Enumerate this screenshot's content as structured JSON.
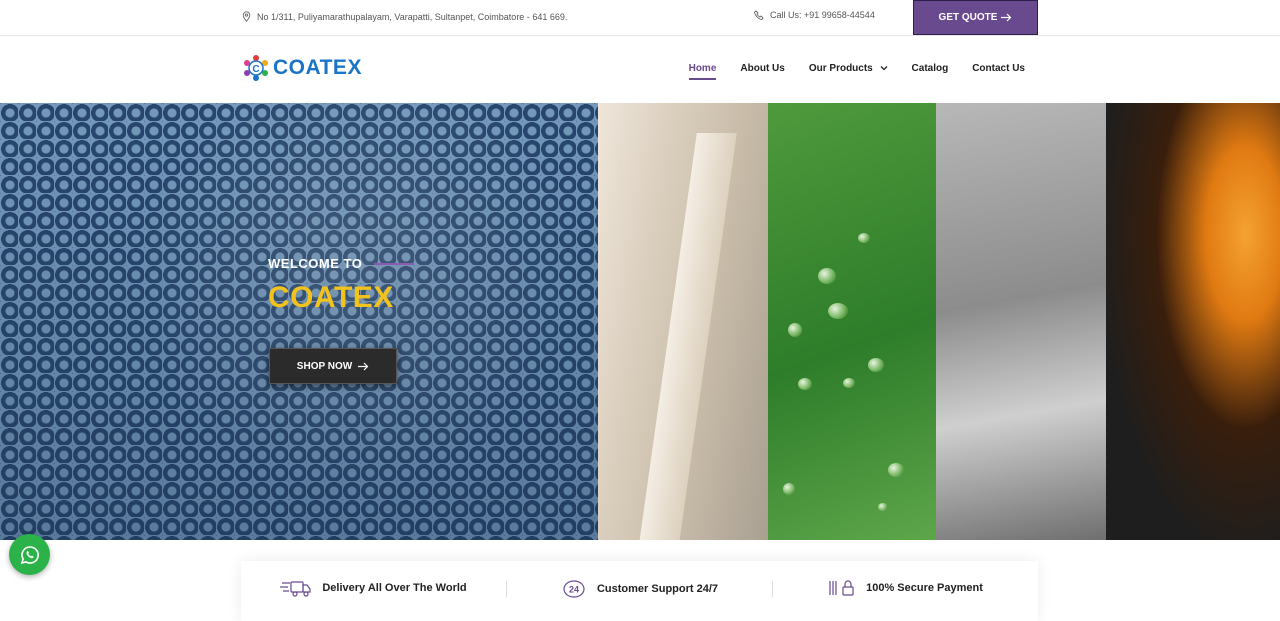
{
  "topbar": {
    "address": "No 1/311, Puliyamarathupalayam, Varapatti, Sultanpet, Coimbatore - 641 669.",
    "address_icon": "location-pin-icon",
    "phone": "Call Us: +91 99658-44544",
    "phone_icon": "phone-icon",
    "quote_label": "GET QUOTE",
    "quote_icon": "arrow-right-icon",
    "quote_color": "#6a4a8f"
  },
  "nav": {
    "logo_text": "COATEX",
    "logo_color": "#1a74c8",
    "items": [
      {
        "label": "Home",
        "active": true
      },
      {
        "label": "About Us"
      },
      {
        "label": "Our Products",
        "has_dropdown": true
      },
      {
        "label": "Catalog"
      },
      {
        "label": "Contact Us"
      }
    ]
  },
  "hero": {
    "welcome": "WELCOME TO",
    "brand": "COATEX",
    "brand_color": "#f2c21d",
    "shop_label": "SHOP NOW",
    "shop_icon": "arrow-right-icon"
  },
  "features": [
    {
      "label": "Delivery All Over The World",
      "icon": "delivery-truck-icon"
    },
    {
      "label": "Customer Support 24/7",
      "icon": "support-24-icon"
    },
    {
      "label": "100% Secure Payment",
      "icon": "secure-payment-icon"
    }
  ],
  "whatsapp": {
    "icon": "whatsapp-icon",
    "color": "#2bb34a"
  }
}
